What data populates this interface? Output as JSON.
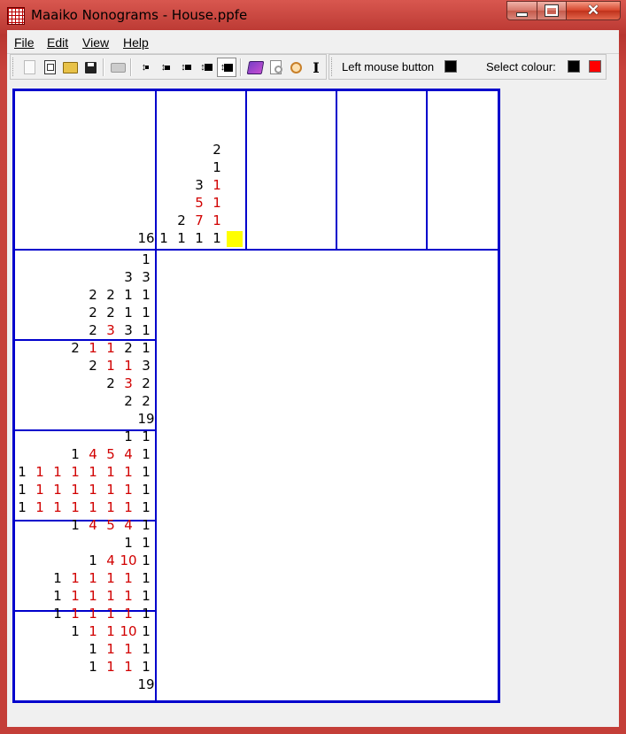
{
  "window": {
    "title": "Maaiko Nonograms - House.ppfe",
    "minimize_icon": "minimize-icon",
    "maximize_icon": "maximize-icon",
    "close_glyph": "✕"
  },
  "menu": [
    {
      "label": "File"
    },
    {
      "label": "Edit"
    },
    {
      "label": "View"
    },
    {
      "label": "Help"
    }
  ],
  "toolbar": {
    "icons": [
      "new-icon",
      "open-template-icon",
      "open-folder-icon",
      "save-icon",
      "print-icon",
      "size-1-icon",
      "size-2-icon",
      "size-3-icon",
      "size-4-icon",
      "size-5-icon",
      "solve-book-icon",
      "preview-icon",
      "search-icon",
      "text-cursor-icon"
    ],
    "left_mouse_label": "Left mouse button",
    "select_colour_label": "Select colour:",
    "left_mouse_colour": "#000000",
    "palette": [
      "#000000",
      "#ff0000"
    ]
  },
  "puzzle": {
    "column_clues": [
      [
        {
          "v": "16",
          "c": "black"
        }
      ],
      [
        {
          "v": "1",
          "c": "black"
        }
      ],
      [
        {
          "v": "2",
          "c": "black"
        },
        {
          "v": "1",
          "c": "black"
        }
      ],
      [
        {
          "v": "3",
          "c": "black"
        },
        {
          "v": "5",
          "c": "red"
        },
        {
          "v": "7",
          "c": "red"
        },
        {
          "v": "1",
          "c": "black"
        }
      ],
      [
        {
          "v": "2",
          "c": "black"
        },
        {
          "v": "1",
          "c": "black"
        },
        {
          "v": "1",
          "c": "red"
        },
        {
          "v": "1",
          "c": "red"
        },
        {
          "v": "1",
          "c": "red"
        },
        {
          "v": "1",
          "c": "black"
        }
      ]
    ],
    "row_clues": [
      [
        {
          "v": "1",
          "c": "black"
        }
      ],
      [
        {
          "v": "3",
          "c": "black"
        },
        {
          "v": "3",
          "c": "black"
        }
      ],
      [
        {
          "v": "2",
          "c": "black"
        },
        {
          "v": "2",
          "c": "black"
        },
        {
          "v": "1",
          "c": "black"
        },
        {
          "v": "1",
          "c": "black"
        }
      ],
      [
        {
          "v": "2",
          "c": "black"
        },
        {
          "v": "2",
          "c": "black"
        },
        {
          "v": "1",
          "c": "black"
        },
        {
          "v": "1",
          "c": "black"
        }
      ],
      [
        {
          "v": "2",
          "c": "black"
        },
        {
          "v": "3",
          "c": "red"
        },
        {
          "v": "3",
          "c": "black"
        },
        {
          "v": "1",
          "c": "black"
        }
      ],
      [
        {
          "v": "2",
          "c": "black"
        },
        {
          "v": "1",
          "c": "red"
        },
        {
          "v": "1",
          "c": "red"
        },
        {
          "v": "2",
          "c": "black"
        },
        {
          "v": "1",
          "c": "black"
        }
      ],
      [
        {
          "v": "2",
          "c": "black"
        },
        {
          "v": "1",
          "c": "red"
        },
        {
          "v": "1",
          "c": "red"
        },
        {
          "v": "3",
          "c": "black"
        }
      ],
      [
        {
          "v": "2",
          "c": "black"
        },
        {
          "v": "3",
          "c": "red"
        },
        {
          "v": "2",
          "c": "black"
        }
      ],
      [
        {
          "v": "2",
          "c": "black"
        },
        {
          "v": "2",
          "c": "black"
        }
      ],
      [
        {
          "v": "19",
          "c": "black"
        }
      ],
      [
        {
          "v": "1",
          "c": "black"
        },
        {
          "v": "1",
          "c": "black"
        }
      ],
      [
        {
          "v": "1",
          "c": "black"
        },
        {
          "v": "4",
          "c": "red"
        },
        {
          "v": "5",
          "c": "red"
        },
        {
          "v": "4",
          "c": "red"
        },
        {
          "v": "1",
          "c": "black"
        }
      ],
      [
        {
          "v": "1",
          "c": "black"
        },
        {
          "v": "1",
          "c": "red"
        },
        {
          "v": "1",
          "c": "red"
        },
        {
          "v": "1",
          "c": "red"
        },
        {
          "v": "1",
          "c": "red"
        },
        {
          "v": "1",
          "c": "red"
        },
        {
          "v": "1",
          "c": "red"
        },
        {
          "v": "1",
          "c": "black"
        }
      ],
      [
        {
          "v": "1",
          "c": "black"
        },
        {
          "v": "1",
          "c": "red"
        },
        {
          "v": "1",
          "c": "red"
        },
        {
          "v": "1",
          "c": "red"
        },
        {
          "v": "1",
          "c": "red"
        },
        {
          "v": "1",
          "c": "red"
        },
        {
          "v": "1",
          "c": "red"
        },
        {
          "v": "1",
          "c": "black"
        }
      ],
      [
        {
          "v": "1",
          "c": "black"
        },
        {
          "v": "1",
          "c": "red"
        },
        {
          "v": "1",
          "c": "red"
        },
        {
          "v": "1",
          "c": "red"
        },
        {
          "v": "1",
          "c": "red"
        },
        {
          "v": "1",
          "c": "red"
        },
        {
          "v": "1",
          "c": "red"
        },
        {
          "v": "1",
          "c": "black"
        }
      ],
      [
        {
          "v": "1",
          "c": "black"
        },
        {
          "v": "4",
          "c": "red"
        },
        {
          "v": "5",
          "c": "red"
        },
        {
          "v": "4",
          "c": "red"
        },
        {
          "v": "1",
          "c": "black"
        }
      ],
      [
        {
          "v": "1",
          "c": "black"
        },
        {
          "v": "1",
          "c": "black"
        }
      ],
      [
        {
          "v": "1",
          "c": "black"
        },
        {
          "v": "4",
          "c": "red"
        },
        {
          "v": "10",
          "c": "red"
        },
        {
          "v": "1",
          "c": "black"
        }
      ],
      [
        {
          "v": "1",
          "c": "black"
        },
        {
          "v": "1",
          "c": "red"
        },
        {
          "v": "1",
          "c": "red"
        },
        {
          "v": "1",
          "c": "red"
        },
        {
          "v": "1",
          "c": "red"
        },
        {
          "v": "1",
          "c": "black"
        }
      ],
      [
        {
          "v": "1",
          "c": "black"
        },
        {
          "v": "1",
          "c": "red"
        },
        {
          "v": "1",
          "c": "red"
        },
        {
          "v": "1",
          "c": "red"
        },
        {
          "v": "1",
          "c": "red"
        },
        {
          "v": "1",
          "c": "black"
        }
      ],
      [
        {
          "v": "1",
          "c": "black"
        },
        {
          "v": "1",
          "c": "red"
        },
        {
          "v": "1",
          "c": "red"
        },
        {
          "v": "1",
          "c": "red"
        },
        {
          "v": "1",
          "c": "red"
        },
        {
          "v": "1",
          "c": "black"
        }
      ],
      [
        {
          "v": "1",
          "c": "black"
        },
        {
          "v": "1",
          "c": "red"
        },
        {
          "v": "1",
          "c": "red"
        },
        {
          "v": "10",
          "c": "red"
        },
        {
          "v": "1",
          "c": "black"
        }
      ],
      [
        {
          "v": "1",
          "c": "black"
        },
        {
          "v": "1",
          "c": "red"
        },
        {
          "v": "1",
          "c": "red"
        },
        {
          "v": "1",
          "c": "black"
        }
      ],
      [
        {
          "v": "1",
          "c": "black"
        },
        {
          "v": "1",
          "c": "red"
        },
        {
          "v": "1",
          "c": "red"
        },
        {
          "v": "1",
          "c": "black"
        }
      ],
      [
        {
          "v": "19",
          "c": "black"
        }
      ]
    ],
    "highlight_colour": "#ffff00",
    "grid_colour": "#0000cc"
  }
}
